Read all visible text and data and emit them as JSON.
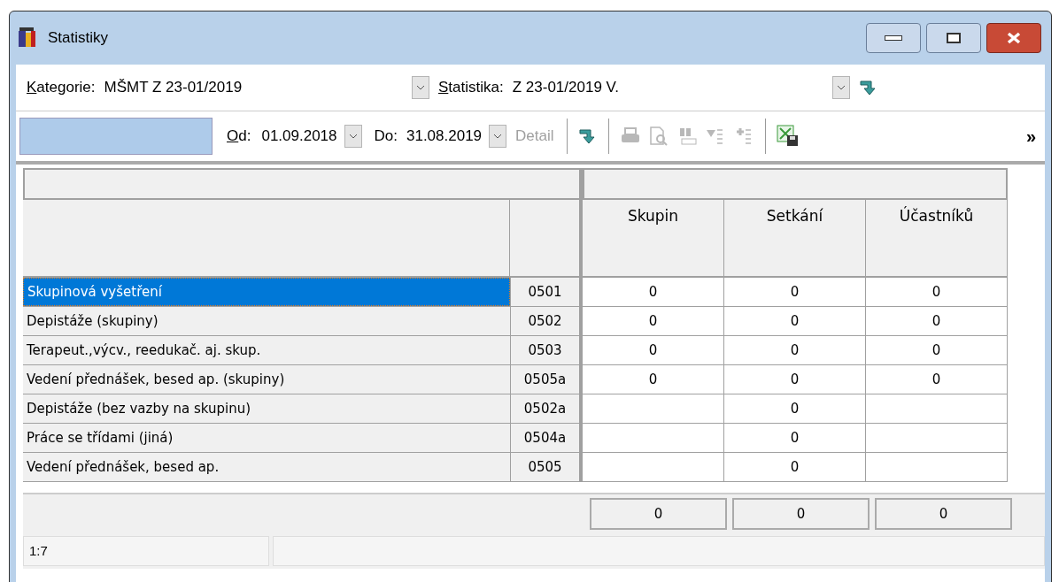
{
  "window": {
    "title": "Statistiky"
  },
  "filter_row": [
    {
      "label": "Kategorie:",
      "access_key": true,
      "value": "MŠMT Z 23-01/2019"
    },
    {
      "label": "Statistika:",
      "access_key": true,
      "value": "Z 23-01/2019 V."
    }
  ],
  "date_row": {
    "from": {
      "label": "Od:",
      "access_key": true,
      "value": "01.09.2018"
    },
    "to": {
      "label": "Do:",
      "access_key": false,
      "value": "31.08.2019"
    },
    "detail": {
      "label": "Detail",
      "disabled": true
    },
    "tools": [
      {
        "kind": "go",
        "disabled": false
      },
      {
        "kind": "print",
        "disabled": true
      },
      {
        "kind": "preview",
        "disabled": true
      },
      {
        "kind": "find",
        "disabled": true
      },
      {
        "kind": "filter",
        "disabled": true
      },
      {
        "kind": "add",
        "disabled": true
      },
      {
        "kind": "export",
        "disabled": false
      }
    ],
    "more": "»"
  },
  "table": {
    "columns": [
      "Skupin",
      "Setkání",
      "Účastníků"
    ],
    "rows": [
      {
        "name": "Skupinová vyšetření",
        "code": "0501",
        "skupin": "0",
        "setkani": "0",
        "ucastniku": "0",
        "selected": true
      },
      {
        "name": "Depistáže (skupiny)",
        "code": "0502",
        "skupin": "0",
        "setkani": "0",
        "ucastniku": "0",
        "selected": false
      },
      {
        "name": "Terapeut.,výcv., reedukač. aj. skup.",
        "code": "0503",
        "skupin": "0",
        "setkani": "0",
        "ucastniku": "0",
        "selected": false
      },
      {
        "name": "Vedení přednášek, besed ap. (skupiny)",
        "code": "0505a",
        "skupin": "0",
        "setkani": "0",
        "ucastniku": "0",
        "selected": false
      },
      {
        "name": "Depistáže (bez vazby na skupinu)",
        "code": "0502a",
        "setkani": "0",
        "selected": false
      },
      {
        "name": "Práce se třídami (jiná)",
        "code": "0504a",
        "setkani": "0",
        "selected": false
      },
      {
        "name": "Vedení přednášek, besed ap.",
        "code": "0505",
        "setkani": "0",
        "selected": false
      }
    ],
    "totals": [
      "0",
      "0",
      "0"
    ]
  },
  "status_bar": {
    "position": "1:7"
  }
}
